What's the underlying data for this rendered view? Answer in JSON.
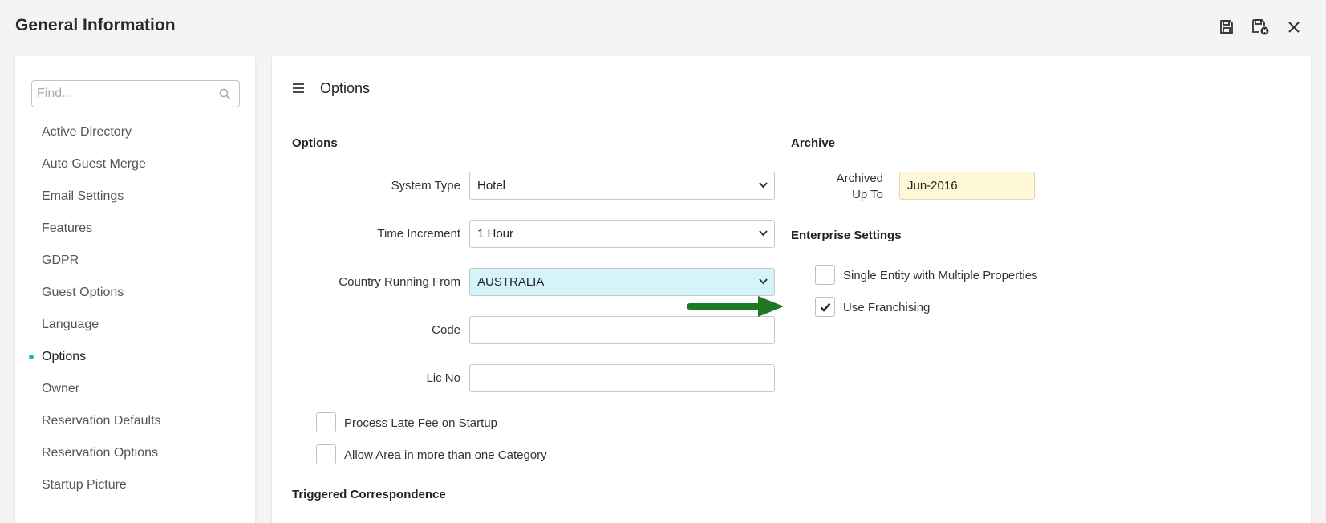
{
  "header": {
    "title": "General Information"
  },
  "sidebar": {
    "search_placeholder": "Find...",
    "items": [
      {
        "label": "Active Directory"
      },
      {
        "label": "Auto Guest Merge"
      },
      {
        "label": "Email Settings"
      },
      {
        "label": "Features"
      },
      {
        "label": "GDPR"
      },
      {
        "label": "Guest Options"
      },
      {
        "label": "Language"
      },
      {
        "label": "Options",
        "active": true
      },
      {
        "label": "Owner"
      },
      {
        "label": "Reservation Defaults"
      },
      {
        "label": "Reservation Options"
      },
      {
        "label": "Startup Picture"
      }
    ],
    "accent_color": "#1ab8c8"
  },
  "main": {
    "title": "Options",
    "options_section": {
      "heading": "Options",
      "system_type": {
        "label": "System Type",
        "value": "Hotel"
      },
      "time_increment": {
        "label": "Time Increment",
        "value": "1 Hour"
      },
      "country": {
        "label": "Country Running From",
        "value": "AUSTRALIA"
      },
      "code": {
        "label": "Code",
        "value": ""
      },
      "lic_no": {
        "label": "Lic No",
        "value": ""
      },
      "process_late_fee": {
        "label": "Process Late Fee on Startup",
        "checked": false
      },
      "allow_area": {
        "label": "Allow Area in more than one Category",
        "checked": false
      }
    },
    "archive_section": {
      "heading": "Archive",
      "archived_label_line1": "Archived",
      "archived_label_line2": "Up To",
      "archived_value": "Jun-2016"
    },
    "enterprise_section": {
      "heading": "Enterprise Settings",
      "single_entity": {
        "label": "Single Entity with Multiple Properties",
        "checked": false
      },
      "use_franchising": {
        "label": "Use Franchising",
        "checked": true
      }
    },
    "triggered_heading": "Triggered Correspondence"
  }
}
